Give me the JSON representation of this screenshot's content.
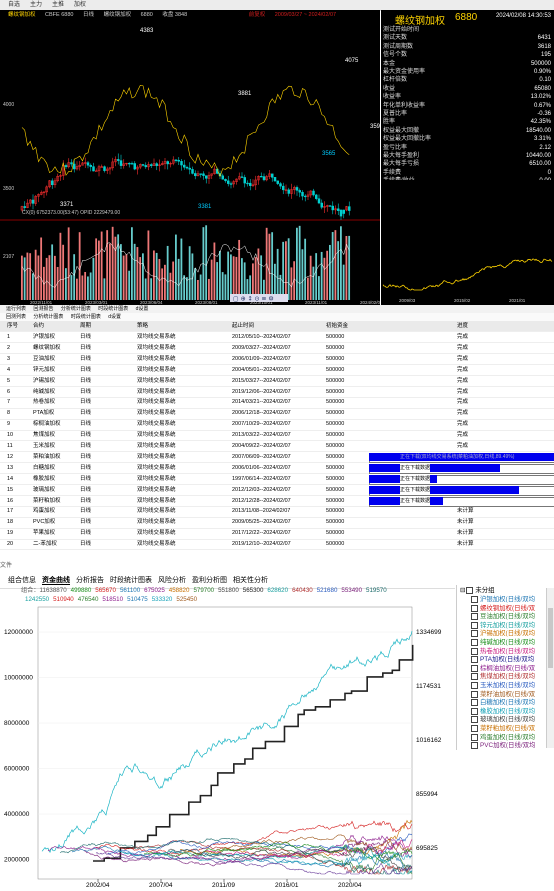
{
  "menu": [
    "自选",
    "主力",
    "主推",
    "加权"
  ],
  "kchart": {
    "info": [
      "螺纹钢加权",
      "CBFE 6880",
      "日线",
      "螺纹钢加权",
      "6880",
      "收盘 3848",
      "前复权",
      "2009/03/27 ~ 2024/02/07"
    ],
    "labels": {
      "high": "4383",
      "low1": "3371",
      "low2": "3381",
      "p1": "4075",
      "p2": "3881",
      "p3": "3565",
      "price": "3590"
    },
    "yticks": [
      "4000",
      "3500"
    ],
    "vol_label": "CX(0)  6752373.00(53:47)  OPID 2229479.00",
    "vol_tick": "2107",
    "xdates": [
      "2022/11/01",
      "2023/03/01",
      "2023/06/04",
      "2023/08/01",
      "2023/10/01",
      "2023/11/01",
      "2024/02/08"
    ],
    "toolbar": "▢ ⊕ ↕ ⊙ ≡ ⚙"
  },
  "stats": {
    "title": "螺纹钢加权",
    "code": "6880",
    "date": "2024/02/08 14:30:53",
    "rows": [
      {
        "k": "测试开始时间",
        "v": ""
      },
      {
        "k": "测试天数",
        "v": "6431"
      },
      {
        "k": "测试周期数",
        "v": "3618"
      },
      {
        "k": "信号个数",
        "v": "195"
      },
      {
        "k": "本金",
        "v": "500000"
      },
      {
        "k": "最大资金使用率",
        "v": "0.90%"
      },
      {
        "k": "杠杆倍数",
        "v": "0.10"
      },
      {
        "k": "收益",
        "v": "65080"
      },
      {
        "k": "收益率",
        "v": "13.02%"
      },
      {
        "k": "年化单利收益率",
        "v": "0.67%"
      },
      {
        "k": "夏普比率",
        "v": "-0.36"
      },
      {
        "k": "胜率",
        "v": "42.35%"
      },
      {
        "k": "权益最大回撤",
        "v": "18540.00"
      },
      {
        "k": "权益最大回撤比率",
        "v": "3.31%"
      },
      {
        "k": "盈亏比率",
        "v": "2.12"
      },
      {
        "k": "最大每手盈利",
        "v": "10440.00"
      },
      {
        "k": "最大每手亏损",
        "v": "6510.00"
      },
      {
        "k": "手续费",
        "v": "0"
      },
      {
        "k": "手续费/收益",
        "v": "0.00"
      }
    ],
    "eq_dates": [
      "2009/03",
      "2015/02",
      "2021/01"
    ]
  },
  "table": {
    "tabs": [
      "运行列表",
      "回测报告",
      "分析统计图表",
      "时段统计图表",
      "d设置"
    ],
    "subtabs": [
      "回测列表",
      "分析统计图表",
      "时段统计图表",
      "d设置"
    ],
    "headers": [
      "序号",
      "合约",
      "周期",
      "策略",
      "起止时间",
      "初始资金",
      "进度"
    ],
    "rows": [
      {
        "n": "1",
        "c": "沪银加权",
        "p": "日线",
        "s": "双均线交易系统",
        "t": "2012/05/10--2024/02/07",
        "m": "500000",
        "st": "完成",
        "prog": 0
      },
      {
        "n": "2",
        "c": "螺纹钢加权",
        "p": "日线",
        "s": "双均线交易系统",
        "t": "2009/03/27--2024/02/07",
        "m": "500000",
        "st": "完成",
        "prog": 0
      },
      {
        "n": "3",
        "c": "豆油加权",
        "p": "日线",
        "s": "双均线交易系统",
        "t": "2006/01/09--2024/02/07",
        "m": "500000",
        "st": "完成",
        "prog": 0
      },
      {
        "n": "4",
        "c": "锌元加权",
        "p": "日线",
        "s": "双均线交易系统",
        "t": "2004/05/01--2024/02/07",
        "m": "500000",
        "st": "完成",
        "prog": 0
      },
      {
        "n": "5",
        "c": "沪锡加权",
        "p": "日线",
        "s": "双均线交易系统",
        "t": "2015/03/27--2024/02/07",
        "m": "500000",
        "st": "完成",
        "prog": 0
      },
      {
        "n": "6",
        "c": "纯碱加权",
        "p": "日线",
        "s": "双均线交易系统",
        "t": "2019/12/06--2024/02/07",
        "m": "500000",
        "st": "完成",
        "prog": 0
      },
      {
        "n": "7",
        "c": "热卷加权",
        "p": "日线",
        "s": "双均线交易系统",
        "t": "2014/03/21--2024/02/07",
        "m": "500000",
        "st": "完成",
        "prog": 0
      },
      {
        "n": "8",
        "c": "PTA加权",
        "p": "日线",
        "s": "双均线交易系统",
        "t": "2006/12/18--2024/02/07",
        "m": "500000",
        "st": "完成",
        "prog": 0
      },
      {
        "n": "9",
        "c": "棕榈油加权",
        "p": "日线",
        "s": "双均线交易系统",
        "t": "2007/10/29--2024/02/07",
        "m": "500000",
        "st": "完成",
        "prog": 0
      },
      {
        "n": "10",
        "c": "焦煤加权",
        "p": "日线",
        "s": "双均线交易系统",
        "t": "2013/03/22--2024/02/07",
        "m": "500000",
        "st": "完成",
        "prog": 0
      },
      {
        "n": "11",
        "c": "玉米加权",
        "p": "日线",
        "s": "双均线交易系统",
        "t": "2004/09/22--2024/02/07",
        "m": "500000",
        "st": "完成",
        "prog": 0
      },
      {
        "n": "12",
        "c": "菜粕油加权",
        "p": "日线",
        "s": "双均线交易系统",
        "t": "2007/06/09--2024/02/07",
        "m": "500000",
        "st": "正在下载(双均线交易系统|菜粕油加权,日线,89.49%)",
        "prog": 1.0
      },
      {
        "n": "13",
        "c": "白糖加权",
        "p": "日线",
        "s": "双均线交易系统",
        "t": "2006/01/06--2024/02/07",
        "m": "500000",
        "st": "正在下载数据",
        "prog": 0.71
      },
      {
        "n": "14",
        "c": "橡胶加权",
        "p": "日线",
        "s": "双均线交易系统",
        "t": "1997/06/14--2024/02/07",
        "m": "500000",
        "st": "正在下载数据",
        "prog": 0.37
      },
      {
        "n": "15",
        "c": "玻璃加权",
        "p": "日线",
        "s": "双均线交易系统",
        "t": "2012/12/03--2024/02/07",
        "m": "500000",
        "st": "正在下载数据",
        "prog": 0.81
      },
      {
        "n": "16",
        "c": "菜籽粕加权",
        "p": "日线",
        "s": "双均线交易系统",
        "t": "2012/12/28--2024/02/07",
        "m": "500000",
        "st": "正在下载数据",
        "prog": 0.4
      },
      {
        "n": "17",
        "c": "鸡蛋加权",
        "p": "日线",
        "s": "双均线交易系统",
        "t": "2013/11/08--2024/02/07",
        "m": "500000",
        "st": "未计算",
        "prog": 0
      },
      {
        "n": "18",
        "c": "PVC加权",
        "p": "日线",
        "s": "双均线交易系统",
        "t": "2009/05/25--2024/02/07",
        "m": "500000",
        "st": "未计算",
        "prog": 0
      },
      {
        "n": "19",
        "c": "苹果加权",
        "p": "日线",
        "s": "双均线交易系统",
        "t": "2017/12/22--2024/02/07",
        "m": "500000",
        "st": "未计算",
        "prog": 0
      },
      {
        "n": "20",
        "c": "二-苯加权",
        "p": "日线",
        "s": "双均线交易系统",
        "t": "2019/12/10--2024/02/07",
        "m": "500000",
        "st": "未计算",
        "prog": 0
      }
    ]
  },
  "bottom": {
    "file_label": "文件",
    "tabs": [
      "组合信息",
      "资金曲线",
      "分析报告",
      "时段统计图表",
      "风险分析",
      "盈利分析图",
      "相关性分析"
    ],
    "active_tab": 1,
    "legend_line1": [
      "组合：11638870",
      "499880",
      "565670",
      "561100",
      "675025",
      "458820",
      "579700",
      "551800",
      "565300",
      "628620",
      "640430",
      "521680",
      "553490",
      "519570"
    ],
    "legend_line2": [
      "1242550",
      "510940",
      "476540",
      "518510",
      "510475",
      "533320",
      "525450"
    ],
    "legend_colors1": [
      "#555555",
      "#1c8f1c",
      "#d41e1e",
      "#1f77b4",
      "#8c1c8c",
      "#c87000",
      "#2f7f2f",
      "#444444",
      "#222222",
      "#19a0a0",
      "#b03030",
      "#2a5cc0",
      "#7a1f7a",
      "#1a6a6a"
    ],
    "legend_colors2": [
      "#19a0a0",
      "#d41e1e",
      "#2f7f2f",
      "#8c1c8c",
      "#1f77b4",
      "#17a2b8",
      "#a05a1e"
    ],
    "yleft": [
      "12000000",
      "10000000",
      "8000000",
      "6000000",
      "4000000",
      "2000000"
    ],
    "yright": [
      "1334699",
      "1174531",
      "1016162",
      "855994",
      "695825",
      "537456"
    ],
    "xdates": [
      "2002/04",
      "2007/04",
      "2011/09",
      "2016/01",
      "2020/04"
    ],
    "tree_root": "未分组",
    "tree_items": [
      {
        "label": "沪银加权(日线/双均",
        "color": "#1f77b4"
      },
      {
        "label": "螺纹钢加权(日线/双",
        "color": "#d41e1e"
      },
      {
        "label": "豆油加权(日线/双均",
        "color": "#2f7f2f"
      },
      {
        "label": "锌元加权(日线/双均",
        "color": "#19a0a0"
      },
      {
        "label": "沪锡加权(日线/双均",
        "color": "#c87000"
      },
      {
        "label": "纯碱加权(日线/双均",
        "color": "#1c8f1c"
      },
      {
        "label": "热卷加权(日线/双均",
        "color": "#c81e80"
      },
      {
        "label": "PTA加权(日线/双均",
        "color": "#1a1a8c"
      },
      {
        "label": "棕榈油加权(日线/双",
        "color": "#8c1c8c"
      },
      {
        "label": "焦煤加权(日线/双均",
        "color": "#b03030"
      },
      {
        "label": "玉米加权(日线/双均",
        "color": "#2a5cc0"
      },
      {
        "label": "菜籽油加权(日线/双",
        "color": "#a05a1e"
      },
      {
        "label": "白糖加权(日线/双均",
        "color": "#1f77b4"
      },
      {
        "label": "橡胶加权(日线/双均",
        "color": "#17a2b8"
      },
      {
        "label": "玻璃加权(日线/双均",
        "color": "#444444"
      },
      {
        "label": "菜籽粕加权(日线/双",
        "color": "#c87000"
      },
      {
        "label": "鸡蛋加权(日线/双均",
        "color": "#2f7f2f"
      },
      {
        "label": "PVC加权(日线/双均",
        "color": "#7a1f7a"
      }
    ]
  }
}
